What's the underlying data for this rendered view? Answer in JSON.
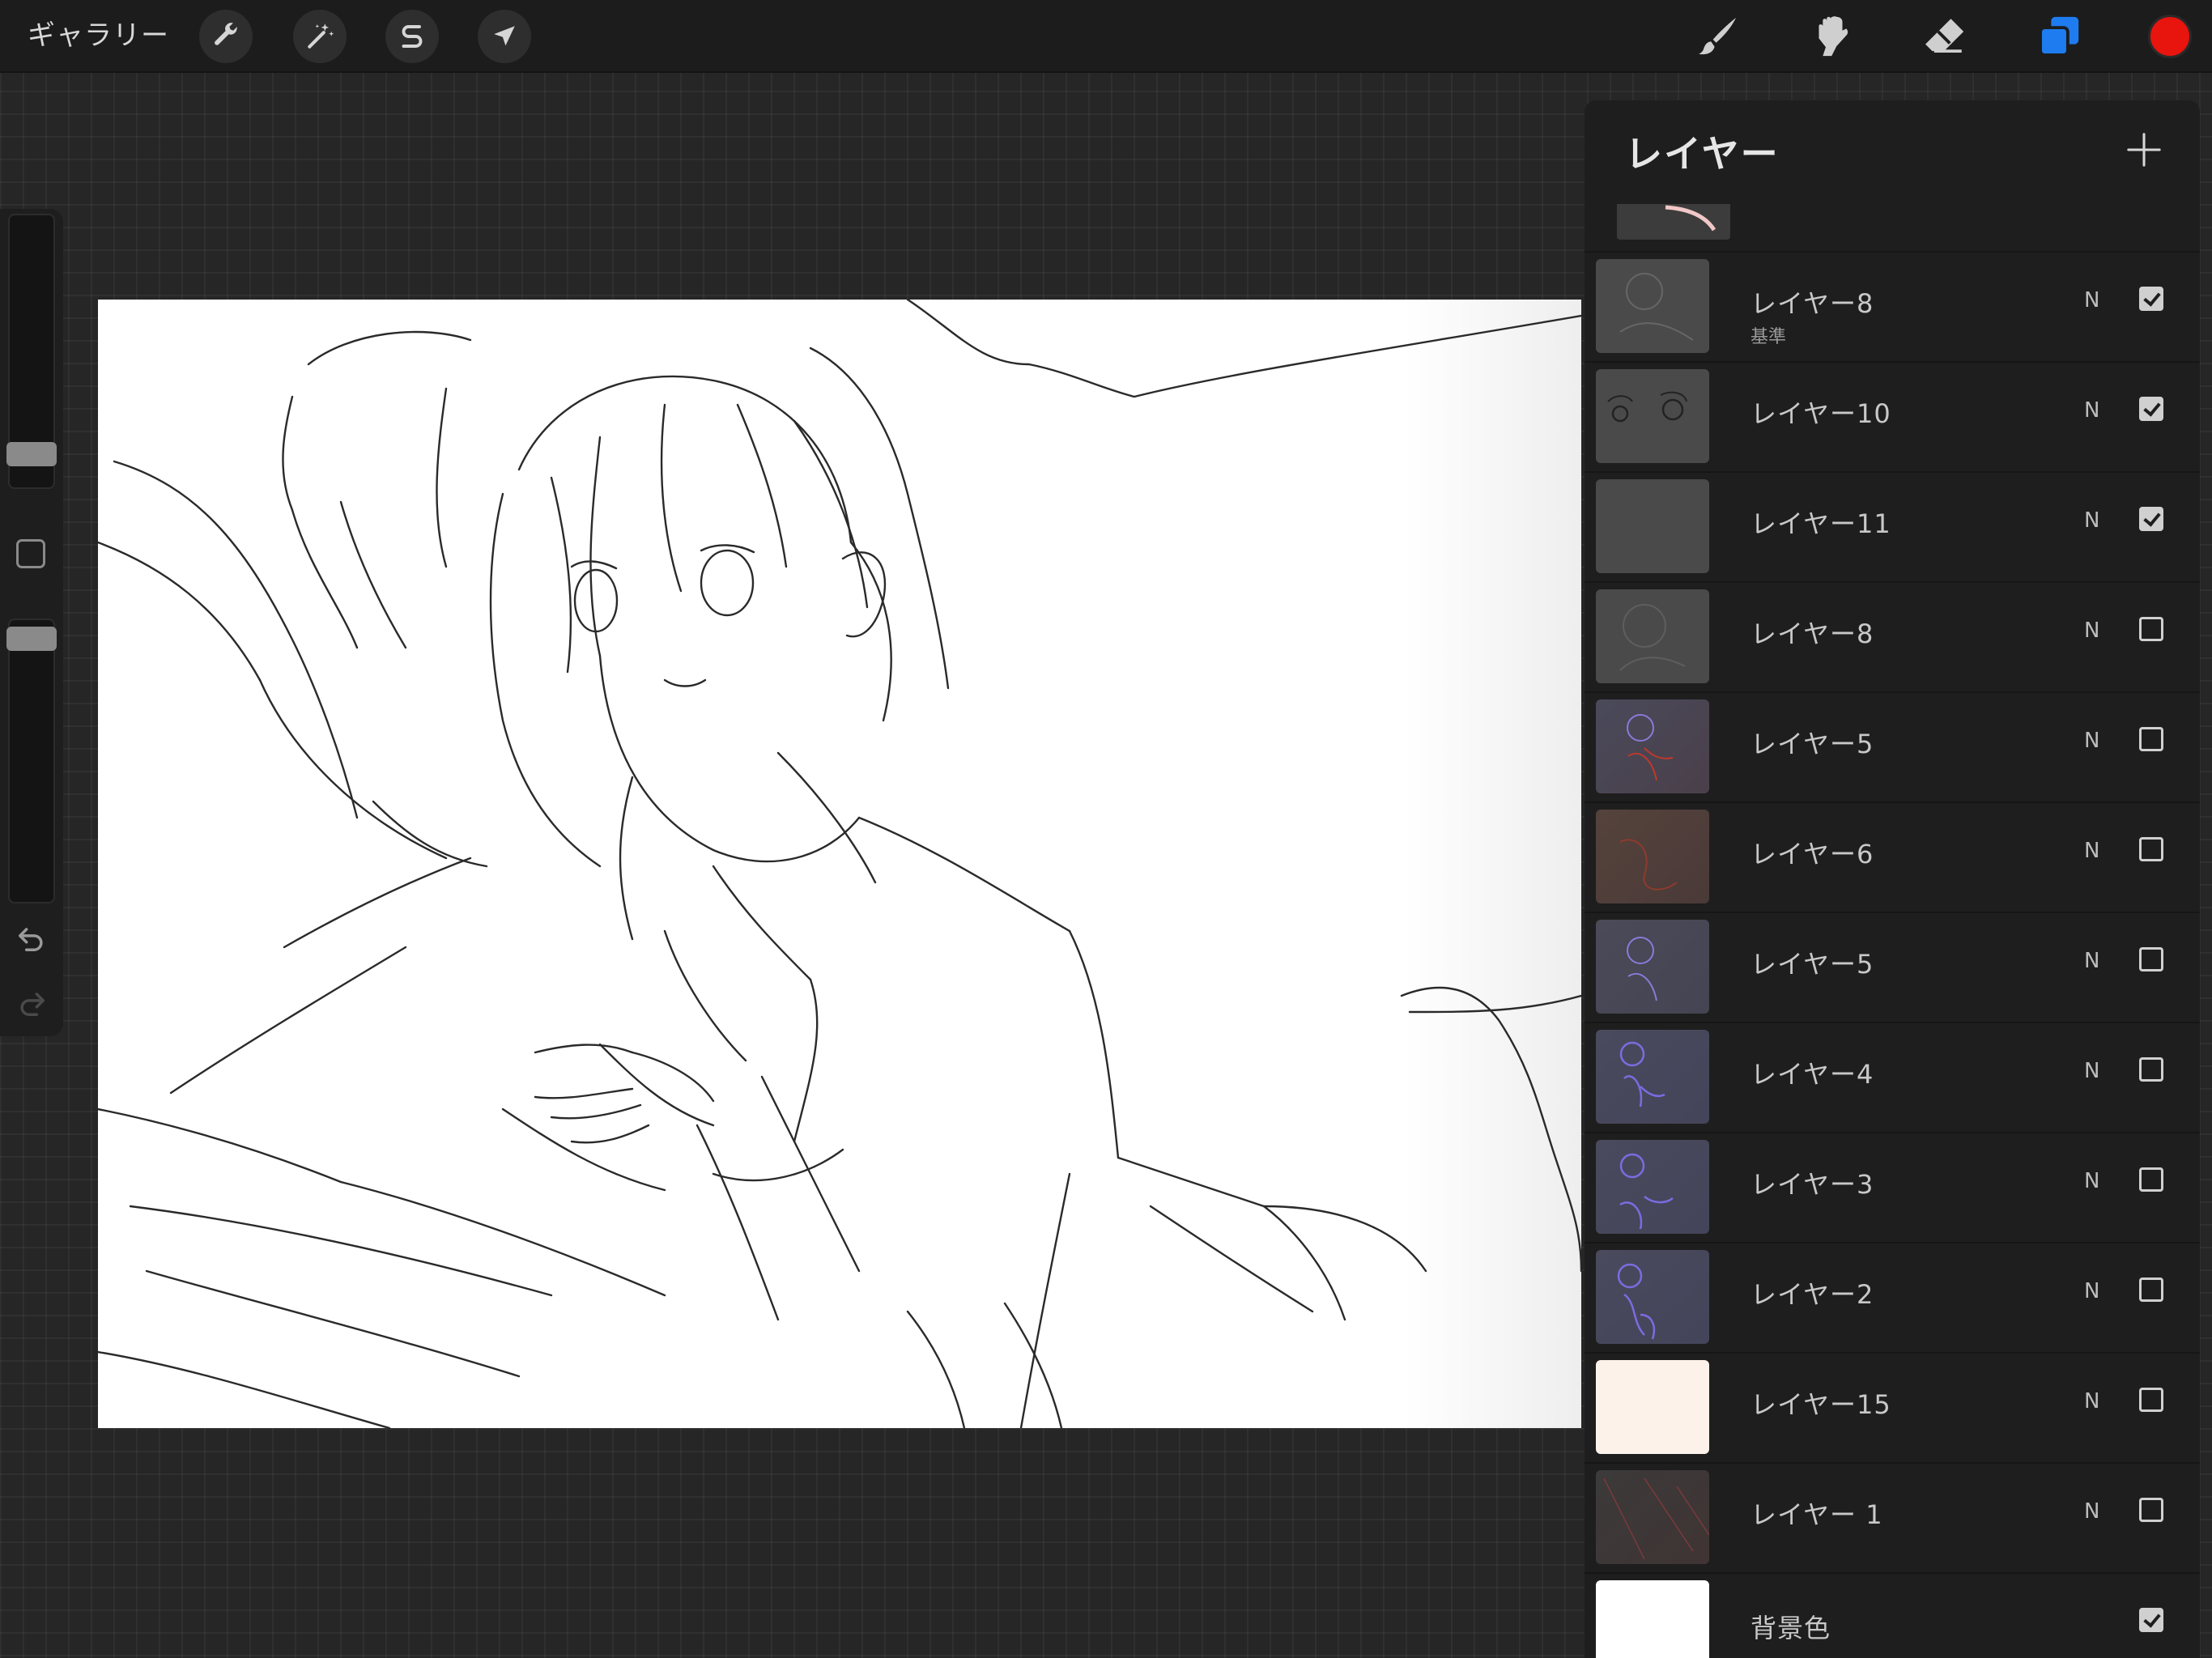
{
  "toolbar": {
    "gallery_label": "ギャラリー",
    "actions_icon": "wrench-icon",
    "adjustments_icon": "magic-wand-icon",
    "selection_icon": "selection-s-icon",
    "transform_icon": "arrow-cursor-icon",
    "brush_icon": "brush-icon",
    "smudge_icon": "smudge-icon",
    "eraser_icon": "eraser-icon",
    "layers_icon": "layers-icon",
    "current_color": "#e8140e",
    "active_accent": "#1e7cf0"
  },
  "sidebar": {
    "brush_size_level": 0.2,
    "opacity_level": 0.04,
    "undo_icon": "undo-arrow-icon",
    "redo_icon": "redo-arrow-icon"
  },
  "layers_panel": {
    "title": "レイヤー",
    "add_icon": "plus-icon",
    "layers": [
      {
        "name": "レイヤー8",
        "sub": "基準",
        "mode": "N",
        "visible": true
      },
      {
        "name": "レイヤー10",
        "sub": "",
        "mode": "N",
        "visible": true
      },
      {
        "name": "レイヤー11",
        "sub": "",
        "mode": "N",
        "visible": true
      },
      {
        "name": "レイヤー8",
        "sub": "",
        "mode": "N",
        "visible": false
      },
      {
        "name": "レイヤー5",
        "sub": "",
        "mode": "N",
        "visible": false
      },
      {
        "name": "レイヤー6",
        "sub": "",
        "mode": "N",
        "visible": false
      },
      {
        "name": "レイヤー5",
        "sub": "",
        "mode": "N",
        "visible": false
      },
      {
        "name": "レイヤー4",
        "sub": "",
        "mode": "N",
        "visible": false
      },
      {
        "name": "レイヤー3",
        "sub": "",
        "mode": "N",
        "visible": false
      },
      {
        "name": "レイヤー2",
        "sub": "",
        "mode": "N",
        "visible": false
      },
      {
        "name": "レイヤー15",
        "sub": "",
        "mode": "N",
        "visible": false
      },
      {
        "name": "レイヤー 1",
        "sub": "",
        "mode": "N",
        "visible": false
      }
    ],
    "background": {
      "name": "背景色",
      "visible": true,
      "color": "#ffffff"
    }
  }
}
